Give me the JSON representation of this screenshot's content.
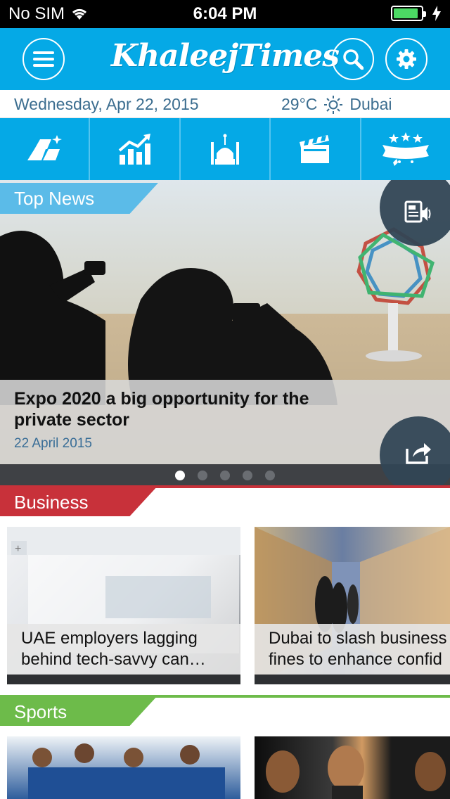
{
  "status_bar": {
    "carrier": "No SIM",
    "time": "6:04 PM"
  },
  "header": {
    "logo": "KhaleejTimes"
  },
  "info_bar": {
    "date": "Wednesday, Apr 22, 2015",
    "temperature": "29°C",
    "city": "Dubai"
  },
  "categories": [
    {
      "icon": "gold-bars-icon"
    },
    {
      "icon": "chart-growth-icon"
    },
    {
      "icon": "mosque-icon"
    },
    {
      "icon": "clapperboard-icon"
    },
    {
      "icon": "stars-banner-icon"
    }
  ],
  "top_news": {
    "label": "Top News",
    "headline": "Expo 2020 a big opportunity for the private sector",
    "date": "22 April 2015",
    "slides": 5,
    "active_slide": 1
  },
  "business": {
    "label": "Business",
    "accent": "#c8313a",
    "articles": [
      {
        "title_line1": "UAE employers lagging",
        "title_line2": "behind tech-savvy can…"
      },
      {
        "title_line1": "Dubai to slash business",
        "title_line2": "fines to enhance confid"
      }
    ]
  },
  "sports": {
    "label": "Sports",
    "accent": "#6dbb4a"
  },
  "colors": {
    "brand": "#05a9e6",
    "caption_date": "#3a6e97"
  }
}
